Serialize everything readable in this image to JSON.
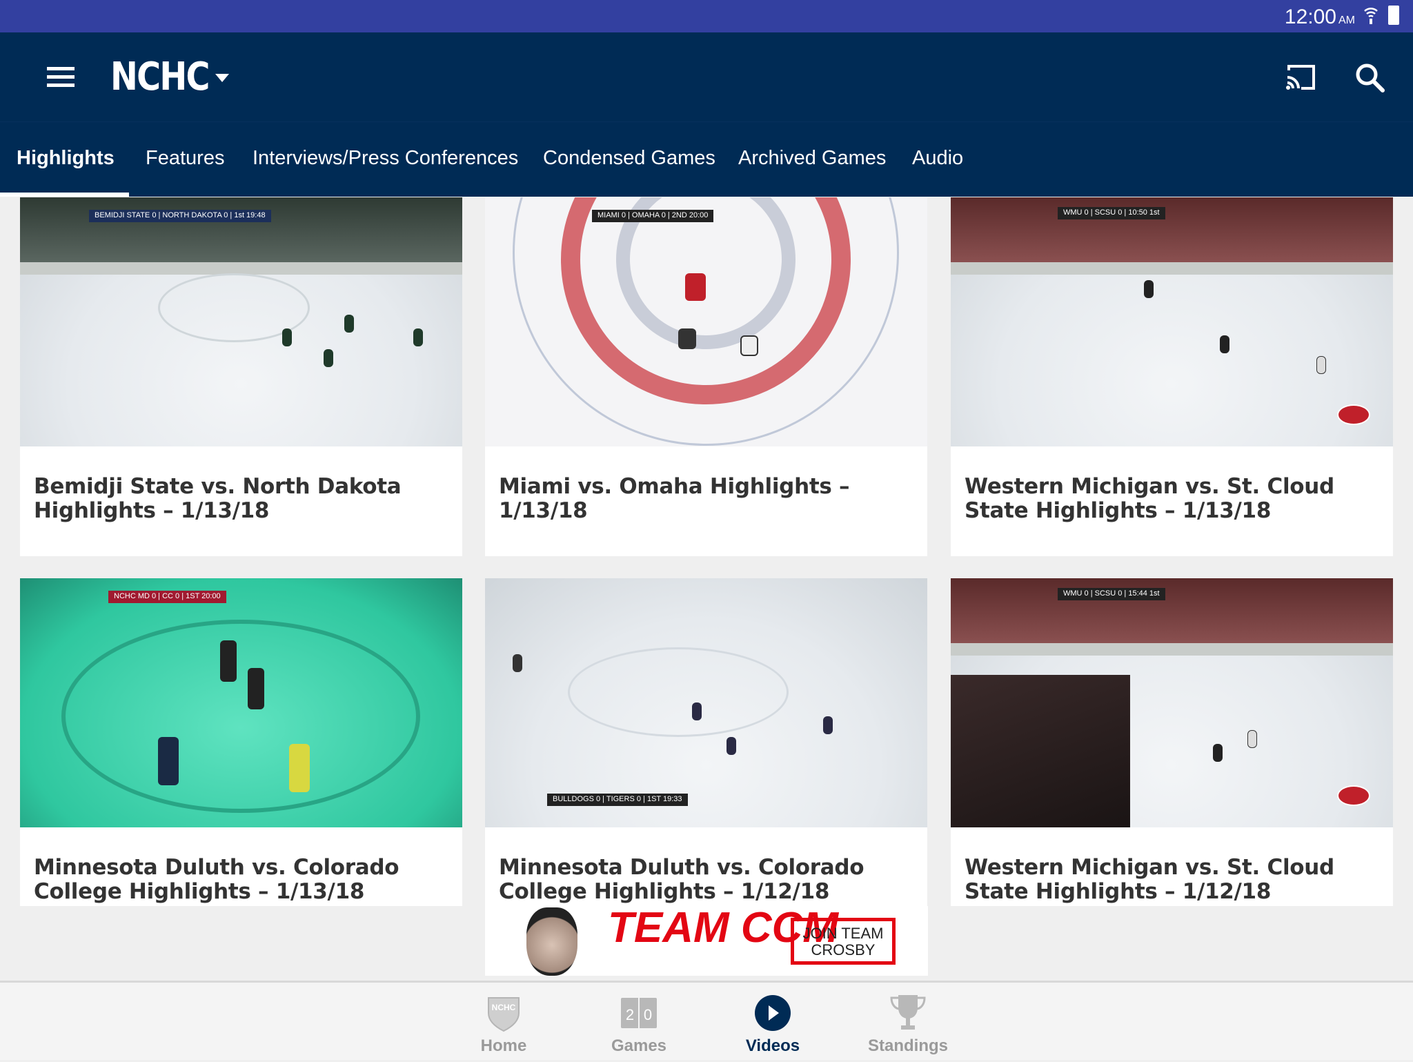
{
  "status_bar": {
    "time": "12:00",
    "ampm": "AM"
  },
  "header": {
    "logo": "NCHC",
    "icons": [
      "menu-icon",
      "dropdown-caret-icon",
      "cast-icon",
      "search-icon"
    ]
  },
  "tabs": [
    {
      "label": "Highlights",
      "active": true
    },
    {
      "label": "Features"
    },
    {
      "label": "Interviews/Press Conferences"
    },
    {
      "label": "Condensed Games"
    },
    {
      "label": "Archived Games"
    },
    {
      "label": "Audio"
    }
  ],
  "videos": [
    {
      "title": "Bemidji State vs. North Dakota Highlights – 1/13/18",
      "scoreboard": "BEMIDJI STATE 0 | NORTH DAKOTA 0 | 1st 19:48"
    },
    {
      "title": "Miami vs. Omaha Highlights – 1/13/18",
      "scoreboard": "MIAMI 0 | OMAHA 0 | 2ND 20:00"
    },
    {
      "title": "Western Michigan vs. St. Cloud State Highlights – 1/13/18",
      "scoreboard": "WMU 0 | SCSU 0 | 10:50 1st"
    },
    {
      "title": "Minnesota Duluth vs. Colorado College Highlights – 1/13/18",
      "scoreboard": "NCHC MD 0 | CC 0 | 1ST 20:00"
    },
    {
      "title": "Minnesota Duluth vs. Colorado College Highlights – 1/12/18",
      "scoreboard": "BULLDOGS 0 | TIGERS 0 | 1ST 19:33"
    },
    {
      "title": "Western Michigan vs. St. Cloud State Highlights – 1/12/18",
      "scoreboard": "WMU 0 | SCSU 0 | 15:44 1st"
    }
  ],
  "ad": {
    "brand": "TEAM CCM",
    "cta": "JOIN TEAM CROSBY",
    "colors": {
      "red": "#e30613"
    }
  },
  "bottom_nav": [
    {
      "label": "Home",
      "icon": "nchc-shield-icon"
    },
    {
      "label": "Games",
      "icon": "scoreboard-icon"
    },
    {
      "label": "Videos",
      "icon": "play-circle-icon",
      "active": true
    },
    {
      "label": "Standings",
      "icon": "trophy-icon"
    }
  ],
  "colors": {
    "status_bar": "#3340a0",
    "header": "#002b55",
    "background": "#efefef"
  }
}
